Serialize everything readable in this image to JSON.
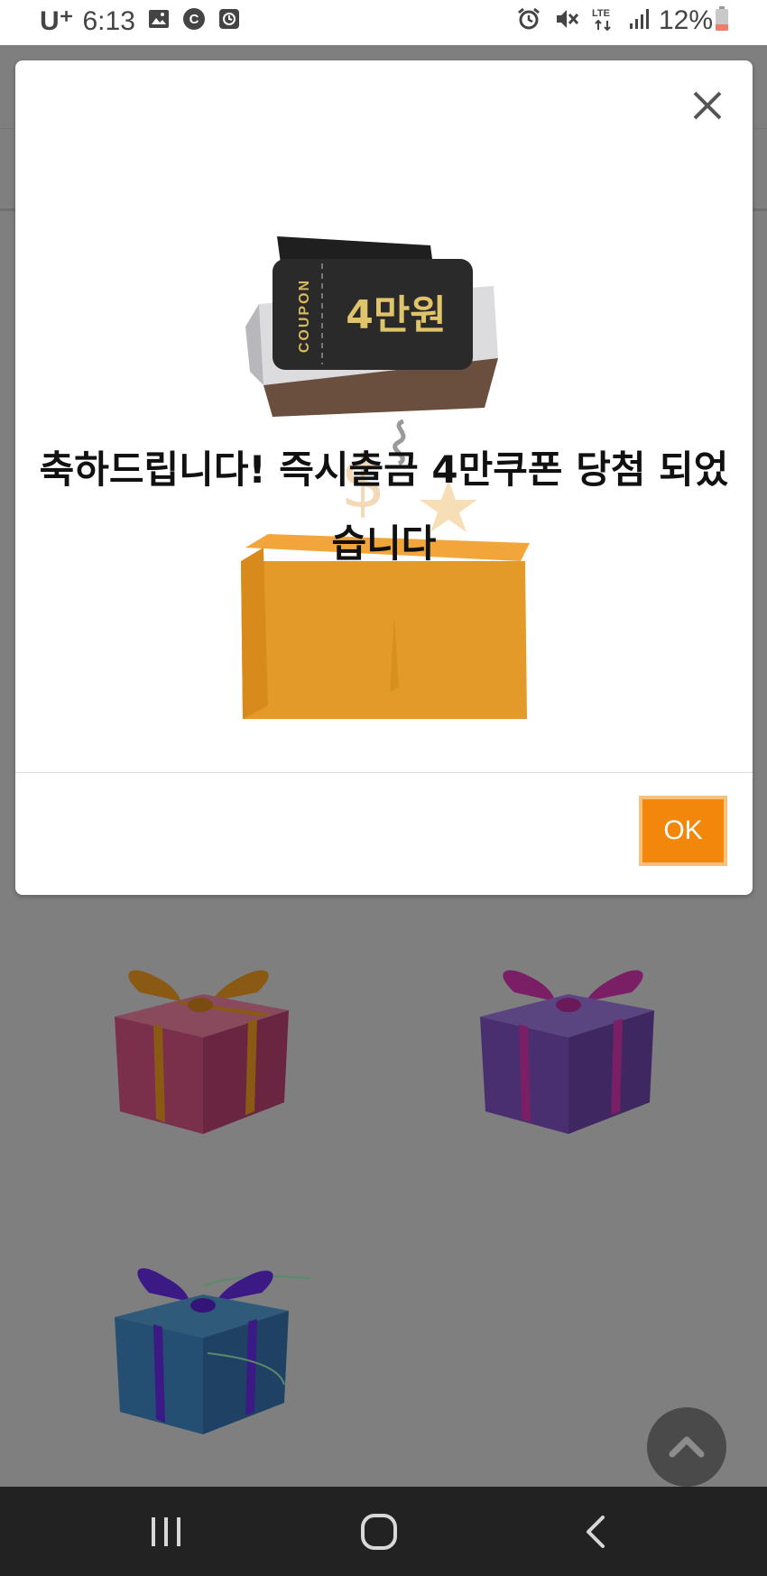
{
  "status_bar": {
    "carrier": "U⁺",
    "time": "6:13",
    "network": "LTE",
    "battery": "12%"
  },
  "dialog": {
    "message_line1": "축하드립니다! 즉시출금 4만쿠폰 당첨 되었",
    "message_line2": "습니다",
    "coupon_label": "COUPON",
    "coupon_amount": "4만원",
    "ok_label": "OK",
    "accent_color": "#f2870c"
  },
  "background": {
    "gift_boxes": [
      "red-gift-icon",
      "purple-gift-icon",
      "blue-gift-icon"
    ]
  }
}
